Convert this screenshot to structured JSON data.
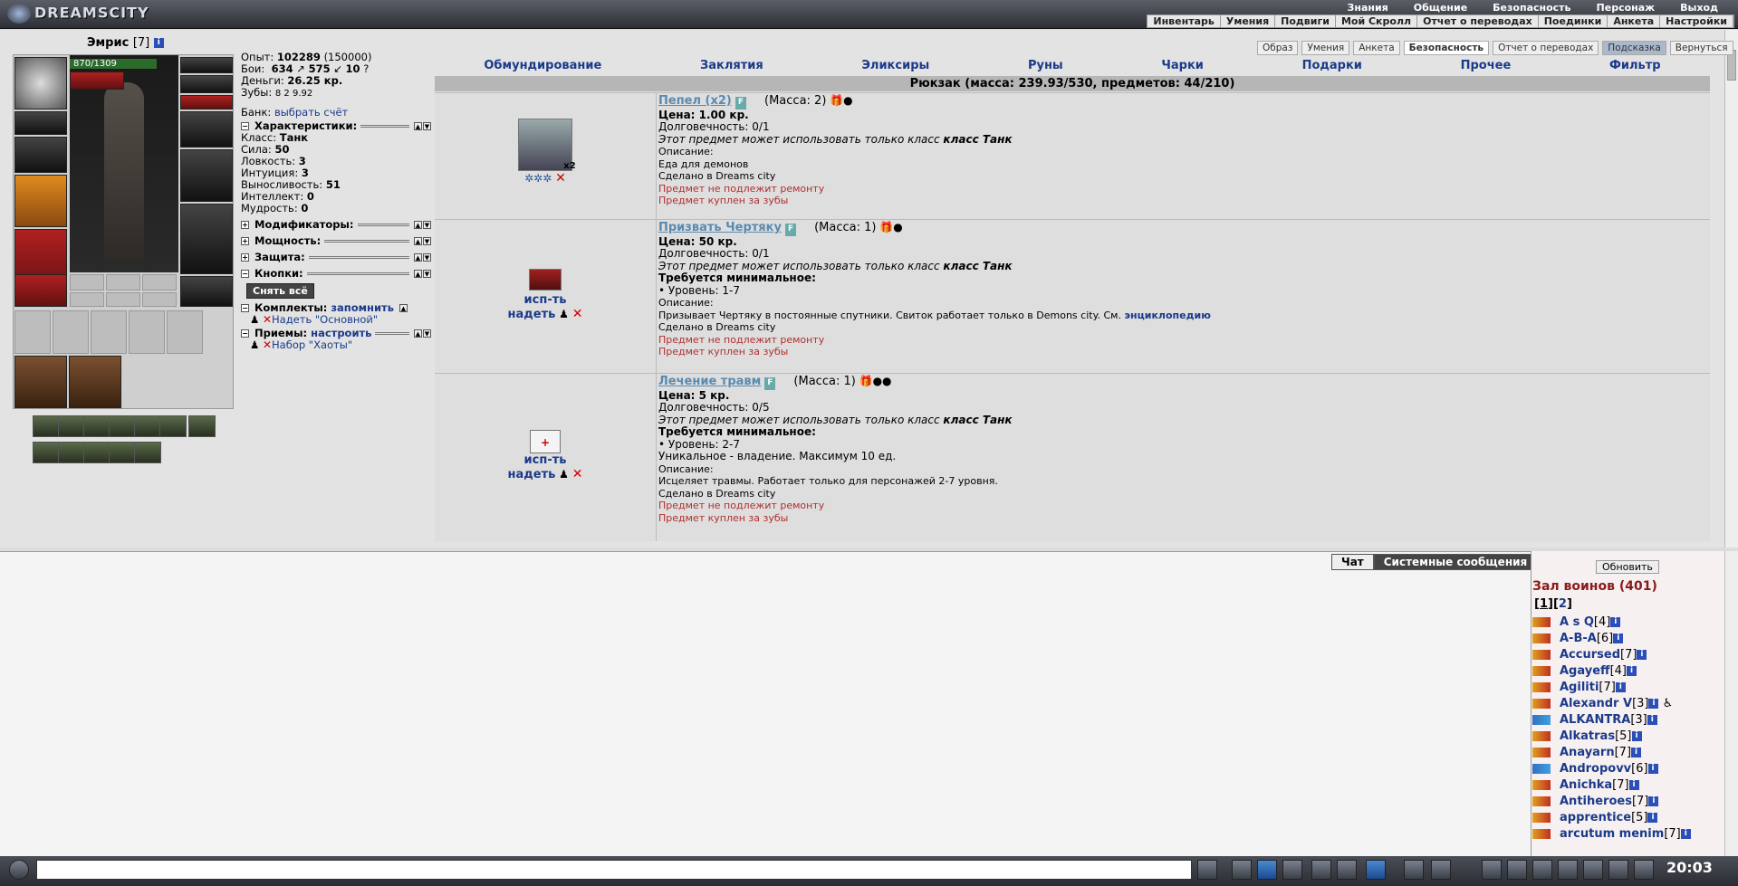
{
  "top": {
    "logo": "DREAMSCITY",
    "menu": [
      "Знания",
      "Общение",
      "Безопасность",
      "Персонаж",
      "Выход"
    ],
    "submenu": [
      "Инвентарь",
      "Умения",
      "Подвиги",
      "Мой Скролл",
      "Отчет о переводах",
      "Поединки",
      "Анкета",
      "Настройки"
    ]
  },
  "char": {
    "name": "Эмрис",
    "level": "[7]",
    "hp": "870/1309",
    "exp_label": "Опыт:",
    "exp": "102289",
    "exp_next": "(150000)",
    "fights_label": "Бои:",
    "wins": "634",
    "losses": "575",
    "draws": "10",
    "money_label": "Деньги:",
    "money": "26.25 кр.",
    "teeth_label": "Зубы:",
    "teeth": "8  2  9.92",
    "bank_label": "Банк:",
    "bank_link": "выбрать счёт",
    "chars_title": "Характеристики:",
    "attrs": [
      {
        "k": "Класс:",
        "v": "Танк"
      },
      {
        "k": "Сила:",
        "v": "50"
      },
      {
        "k": "Ловкость:",
        "v": "3"
      },
      {
        "k": "Интуиция:",
        "v": "3"
      },
      {
        "k": "Выносливость:",
        "v": "51"
      },
      {
        "k": "Интеллект:",
        "v": "0"
      },
      {
        "k": "Мудрость:",
        "v": "0"
      }
    ],
    "mods": "Модификаторы:",
    "power": "Мощность:",
    "defense": "Защита:",
    "buttons": "Кнопки:",
    "unequip_all": "Снять всё",
    "sets_label": "Комплекты:",
    "sets_remember": "запомнить",
    "set_item": "Надеть \"Основной\"",
    "tricks_label": "Приемы:",
    "tricks_setup": "настроить",
    "trick_item": "Набор \"Хаоты\""
  },
  "tabs": [
    "Образ",
    "Умения",
    "Анкета",
    "Безопасность",
    "Отчет о переводах",
    "Подсказка",
    "Вернуться"
  ],
  "categories": [
    "Обмундирование",
    "Заклятия",
    "Эликсиры",
    "Руны",
    "Чарки",
    "Подарки",
    "Прочее",
    "Фильтр"
  ],
  "backpack": "Рюкзак (масса: 239.93/530, предметов: 44/210)",
  "items": [
    {
      "name": "Пепел (x2)",
      "mass": "(Масса: 2)",
      "count": "x2",
      "price": "Цена: 1.00 кр.",
      "dur": "Долговечность: 0/1",
      "cls": "Этот предмет может использовать только класс",
      "cls_b": "класс Танк",
      "desc_label": "Описание:",
      "desc": "Еда для демонов",
      "made": "Сделано в Dreams city",
      "norepair": "Предмет не подлежит ремонту",
      "bought": "Предмет куплен за зубы"
    },
    {
      "name": "Призвать Чертяку",
      "mass": "(Масса: 1)",
      "price": "Цена: 50 кр.",
      "dur": "Долговечность: 0/1",
      "cls": "Этот предмет может использовать только класс",
      "cls_b": "класс Танк",
      "req": "Требуется минимальное:",
      "req_lvl": "• Уровень: 1-7",
      "desc_label": "Описание:",
      "desc": "Призывает Чертяку в постоянные спутники. Свиток работает только в Demons city. См.",
      "desc_link": "энциклопедию",
      "made": "Сделано в Dreams city",
      "norepair": "Предмет не подлежит ремонту",
      "bought": "Предмет куплен за зубы",
      "use": "исп-ть",
      "wear": "надеть"
    },
    {
      "name": "Лечение травм",
      "mass": "(Масса: 1)",
      "price": "Цена: 5 кр.",
      "dur": "Долговечность: 0/5",
      "cls": "Этот предмет может использовать только класс",
      "cls_b": "класс Танк",
      "req": "Требуется минимальное:",
      "req_lvl": "• Уровень: 2-7",
      "uniq": "Уникальное - владение. Максимум 10 ед.",
      "desc_label": "Описание:",
      "desc": "Исцеляет травмы. Работает только для персонажей 2-7 уровня.",
      "made": "Сделано в Dreams city",
      "norepair": "Предмет не подлежит ремонту",
      "bought": "Предмет куплен за зубы",
      "use": "исп-ть",
      "wear": "надеть"
    }
  ],
  "chat": {
    "tab_chat": "Чат",
    "tab_system": "Системные сообщения"
  },
  "users": {
    "refresh": "Обновить",
    "hall": "Зал воинов (401)",
    "page1": "1",
    "page2": "2",
    "list": [
      {
        "n": "A s Q",
        "l": "[4]"
      },
      {
        "n": "A-B-A",
        "l": "[6]"
      },
      {
        "n": "Accursed",
        "l": "[7]"
      },
      {
        "n": "Agayeff",
        "l": "[4]"
      },
      {
        "n": "Agiliti",
        "l": "[7]"
      },
      {
        "n": "Alexandr V",
        "l": "[3]"
      },
      {
        "n": "ALKANTRA",
        "l": "[3]"
      },
      {
        "n": "Alkatras",
        "l": "[5]"
      },
      {
        "n": "Anayarn",
        "l": "[7]"
      },
      {
        "n": "Andropovv",
        "l": "[6]"
      },
      {
        "n": "Anichka",
        "l": "[7]"
      },
      {
        "n": "Antiheroes",
        "l": "[7]"
      },
      {
        "n": "apprentice",
        "l": "[5]"
      },
      {
        "n": "arcutum menim",
        "l": "[7]"
      }
    ]
  },
  "clock": "20:03"
}
